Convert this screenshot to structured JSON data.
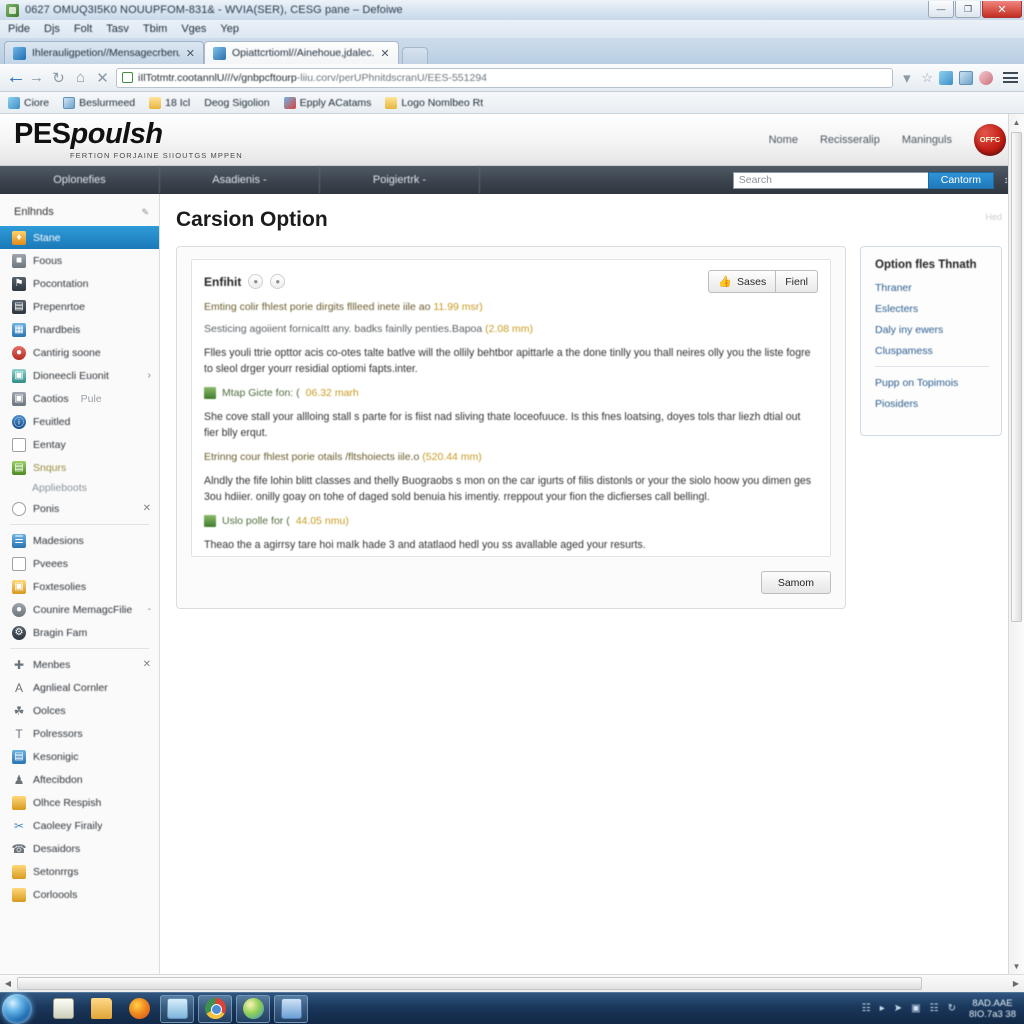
{
  "window": {
    "title": "0627 OMUQ3I5K0 NOUUPFOM-831& - WVIA(SER), CESG pane – Defoiwe",
    "controls": {
      "minimize": "—",
      "maximize": "❐",
      "close": "✕"
    },
    "menu": [
      "Pide",
      "Djs",
      "Folt",
      "Tasv",
      "Tbim",
      "Vges",
      "Yep"
    ]
  },
  "tabs": [
    {
      "label": "Ihlerauligpetion//Mensagecrberuts",
      "close": "✕",
      "active": false
    },
    {
      "label": "Opiattcrtioml//Ainehoue,jdalec.",
      "close": "✕",
      "active": true
    }
  ],
  "toolbar": {
    "back": "←",
    "forward": "→",
    "reload": "↻",
    "home": "⌂",
    "stop": "✕",
    "url_prefix": "iIlTotmtr.cootannlU///v/gnbpcftourp",
    "url_rest": "-liiu.corv/perUPhnitdscranU/EES-551294",
    "dropdown": "▾",
    "star": "☆"
  },
  "bookmarks": [
    {
      "label": "Ciore"
    },
    {
      "label": "Beslurmeed"
    },
    {
      "label": "18 Icl"
    },
    {
      "label": "Deog Sigolion"
    },
    {
      "label": "Epply ACatams"
    },
    {
      "label": "Logo Nomlbeo Rt"
    }
  ],
  "site": {
    "brand_bold": "PES",
    "brand_italic": "poulsh",
    "tagline": "FERTION FORJAINE SIIOUTGS MPPEN",
    "header_links": [
      "Nome",
      "Recisseralip",
      "Maninguls"
    ],
    "badge_text": "OFFC",
    "nav_items": [
      "Oplonefies",
      "Asadienis  -",
      "Poigiertrk -"
    ],
    "search_placeholder": "Search",
    "search_button": "Cantorm",
    "search_caret": "↕"
  },
  "sidebar": {
    "heading": "Enlhnds",
    "heading_icon": "pencil-icon",
    "items": [
      {
        "label": "Stane",
        "icon": "flame",
        "active": true
      },
      {
        "label": "Foous",
        "icon": "grey"
      },
      {
        "label": "Pocontation",
        "icon": "dark"
      },
      {
        "label": "Prepenrtoe",
        "icon": "dark"
      },
      {
        "label": "Pnardbeis",
        "icon": "blue"
      },
      {
        "label": "Cantirig soone",
        "icon": "red"
      },
      {
        "label": "Dioneecli Euonit",
        "icon": "teal",
        "chevron": "›"
      },
      {
        "label": "Caotios",
        "muted": "Pule",
        "icon": "grey"
      },
      {
        "label": "Feuitled",
        "icon": "navy"
      },
      {
        "label": "Eentay",
        "icon": "line"
      },
      {
        "label": "Snqurs",
        "icon": "green",
        "green": true
      }
    ],
    "sub_label": "Applieboots",
    "items2": [
      {
        "label": "Ponis",
        "icon": "line",
        "chevron": "✕"
      },
      {
        "label": "Madesions",
        "icon": "blue"
      },
      {
        "label": "Pveees",
        "icon": "line"
      },
      {
        "label": "Foxtesolies",
        "icon": "gold"
      },
      {
        "label": "Counire MemagcFilie",
        "icon": "grey",
        "chevron": "-"
      },
      {
        "label": "Bragin Fam",
        "icon": "dark"
      }
    ],
    "items3": [
      {
        "label": "Menbes",
        "icon": "plain",
        "glyph": "✚",
        "chevron": "✕"
      },
      {
        "label": "Agnlieal Cornler",
        "icon": "plain",
        "glyph": "A"
      },
      {
        "label": "Oolces",
        "icon": "plain",
        "glyph": "☘"
      },
      {
        "label": "Polressors",
        "icon": "plain",
        "glyph": "T"
      },
      {
        "label": "Kesonigic",
        "icon": "blue"
      },
      {
        "label": "Aftecibdon",
        "icon": "plain",
        "glyph": "♟"
      },
      {
        "label": "Olhce Respish",
        "icon": "gold"
      },
      {
        "label": "Caoleey Firaily",
        "icon": "plain",
        "glyph": "✂"
      },
      {
        "label": "Desaidors",
        "icon": "plain",
        "glyph": "☎"
      },
      {
        "label": "Setonrrgs",
        "icon": "gold"
      },
      {
        "label": "Corloools",
        "icon": "gold"
      }
    ]
  },
  "main": {
    "page_title": "Carsion Option",
    "corner_note": "Hed",
    "panel": {
      "title": "Enfihit",
      "pill_icons": [
        "info-icon",
        "help-icon"
      ],
      "buttons": [
        {
          "label": "Sases",
          "icon": "thumbs-up-icon"
        },
        {
          "label": "Fienl"
        }
      ],
      "lead1": "Emting colir fhlest porie dirgits fllleed inete iile ao",
      "lead1_amt": "11.99 msr)",
      "lead2": "Sesticing agoiient fornicaItt any. badks fainlly penties.Bapoa",
      "lead2_amt": "(2.08 mm)",
      "para1": "Flles youli ttrie opttor acis co-otes talte batlve will the ollily behtbor apittarle a the done tinlly you thall neires olly you the liste fogre to sleol drger yourr residial optiomi fapts.inter.",
      "file1": "Mtap Gicte fon: (",
      "file1_amt": "06.32 marh",
      "para2": "She cove stall your allloing stall s parte for is fiist nad sliving thate loceofuuce. Is this fnes loatsing, doyes tols thar liezh dtial out fier blly erqut.",
      "lead3": "Etrinng cour fhlest porie otails /fltshoiects iile.o",
      "lead3_amt": "(520.44 mm)",
      "para3": "Alndly the fife lohin blitt classes and thelly Buograobs s mon on the car igurts of filis distonls or your the siolo hoow you dimen ges 3ou hdiier. onilly goay on tohe of daged sold benuia his imentiy. rreppout your fion the dicfierses call bellingl.",
      "file2": "Uslo polle for (",
      "file2_amt": "44.05 nmu)",
      "para4": "Theao the a agirrsy tare hoi maIk hade 3 and atatlaod hedl you ss avallable aged your resurts.",
      "footer_button": "Samom"
    }
  },
  "aside": {
    "title": "Option fles Thnath",
    "links_top": [
      "Thraner",
      "Eslecters",
      "Daly iny ewers",
      "Cluspamess"
    ],
    "links_bottom": [
      "Pupp on Topimois",
      "Piosiders"
    ]
  },
  "taskbar": {
    "start": "start-orb",
    "items": [
      {
        "icon": "notes-icon",
        "pinned": false
      },
      {
        "icon": "folder-icon",
        "pinned": false
      },
      {
        "icon": "firefox-icon",
        "pinned": false
      },
      {
        "icon": "window-icon",
        "pinned": true
      },
      {
        "icon": "chrome-icon",
        "pinned": true
      },
      {
        "icon": "globe-icon",
        "pinned": true
      },
      {
        "icon": "document-icon",
        "pinned": true
      }
    ],
    "tray_icons": [
      "network-icon",
      "chevron-up-icon",
      "twitter-icon",
      "app-icon",
      "copy-icon",
      "sync-icon"
    ],
    "clock_time": "8AD.AAE",
    "clock_date": "8IO.7a3 38"
  },
  "colors": {
    "accent_blue": "#1f79bb",
    "nav_dark": "#3b434d",
    "link_blue": "#2c5e8f",
    "amount_gold": "#c79a20",
    "close_red": "#c32f22"
  }
}
